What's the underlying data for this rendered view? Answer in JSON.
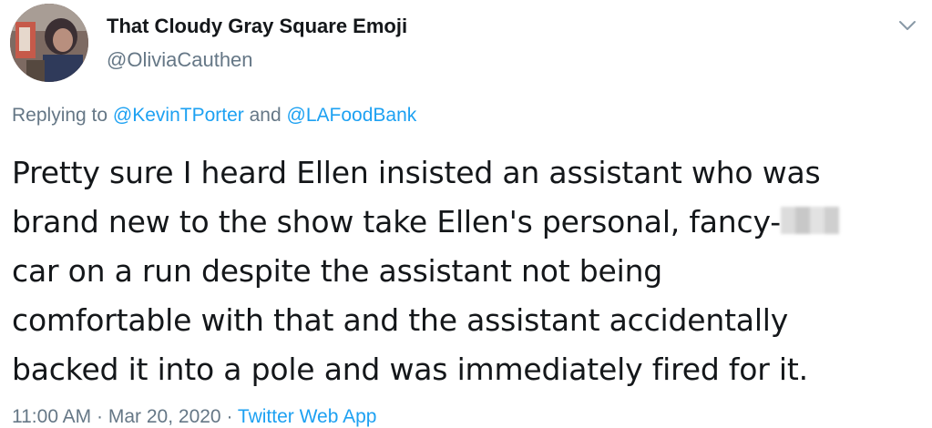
{
  "user": {
    "display_name": "That Cloudy Gray Square Emoji",
    "handle": "@OliviaCauthen",
    "avatar_icon": "profile-photo"
  },
  "reply": {
    "prefix": "Replying to",
    "mention1": "@KevinTPorter",
    "conjunction": "and",
    "mention2": "@LAFoodBank"
  },
  "tweet": {
    "lines": [
      "Pretty sure I heard Ellen insisted an assistant who was",
      "brand new to the show take Ellen's personal, fancy-",
      "car on a run despite the assistant not being",
      "comfortable with that and the assistant accidentally",
      "backed it into a pole and was immediately fired for it."
    ],
    "censored_icon": "blurred-word"
  },
  "meta": {
    "time": "11:00 AM",
    "separator": "·",
    "date": "Mar 20, 2020",
    "app": "Twitter Web App"
  },
  "colors": {
    "text": "#14171a",
    "secondary": "#657786",
    "link": "#1da1f2"
  },
  "icons": {
    "menu": "chevron-down-icon"
  }
}
